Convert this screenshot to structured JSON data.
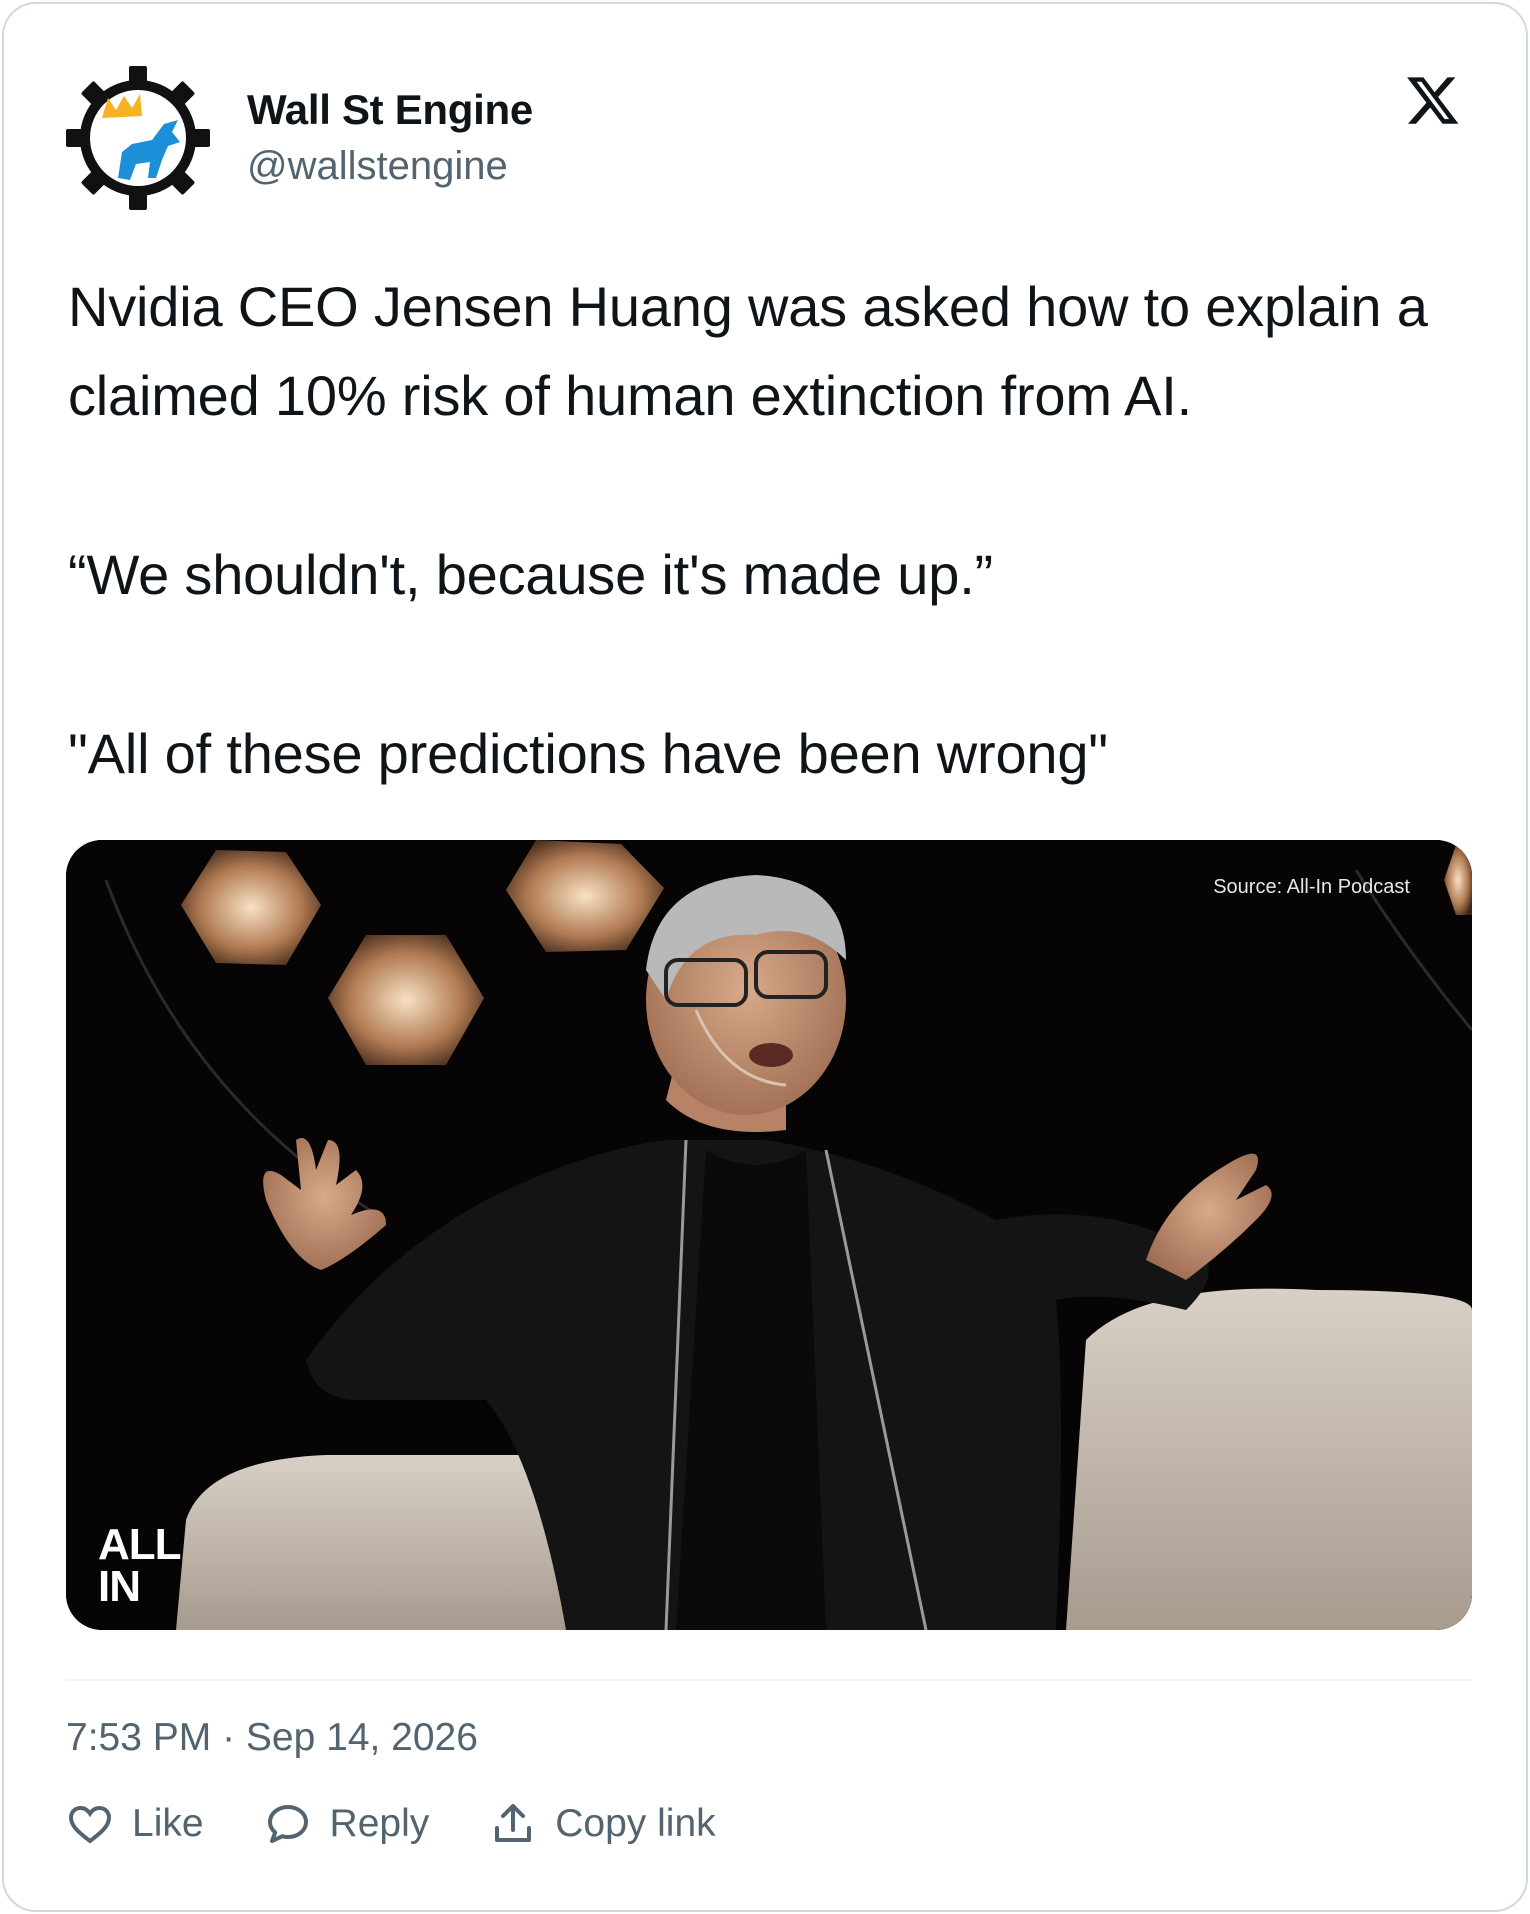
{
  "author": {
    "display_name": "Wall St Engine",
    "handle": "@wallstengine",
    "avatar_icon": "gear-bull-logo-icon"
  },
  "platform_icon": "x-logo-icon",
  "post": {
    "paragraphs": [
      "Nvidia CEO Jensen Huang was asked how to explain a claimed 10% risk of human extinction from AI.",
      "“We shouldn't, because it's made up.”",
      "\"All of these predictions have been wrong\""
    ]
  },
  "media": {
    "source_caption": "Source: All-In Podcast",
    "watermark_line1": "ALL",
    "watermark_line2": "IN"
  },
  "timestamp": "7:53 PM · Sep 14, 2026",
  "actions": {
    "like_label": "Like",
    "reply_label": "Reply",
    "copy_link_label": "Copy link"
  },
  "colors": {
    "text_primary": "#0f1419",
    "text_secondary": "#536471",
    "border": "#cfd9de",
    "bull_blue": "#1d8fd8",
    "crown_gold": "#f5b324"
  }
}
